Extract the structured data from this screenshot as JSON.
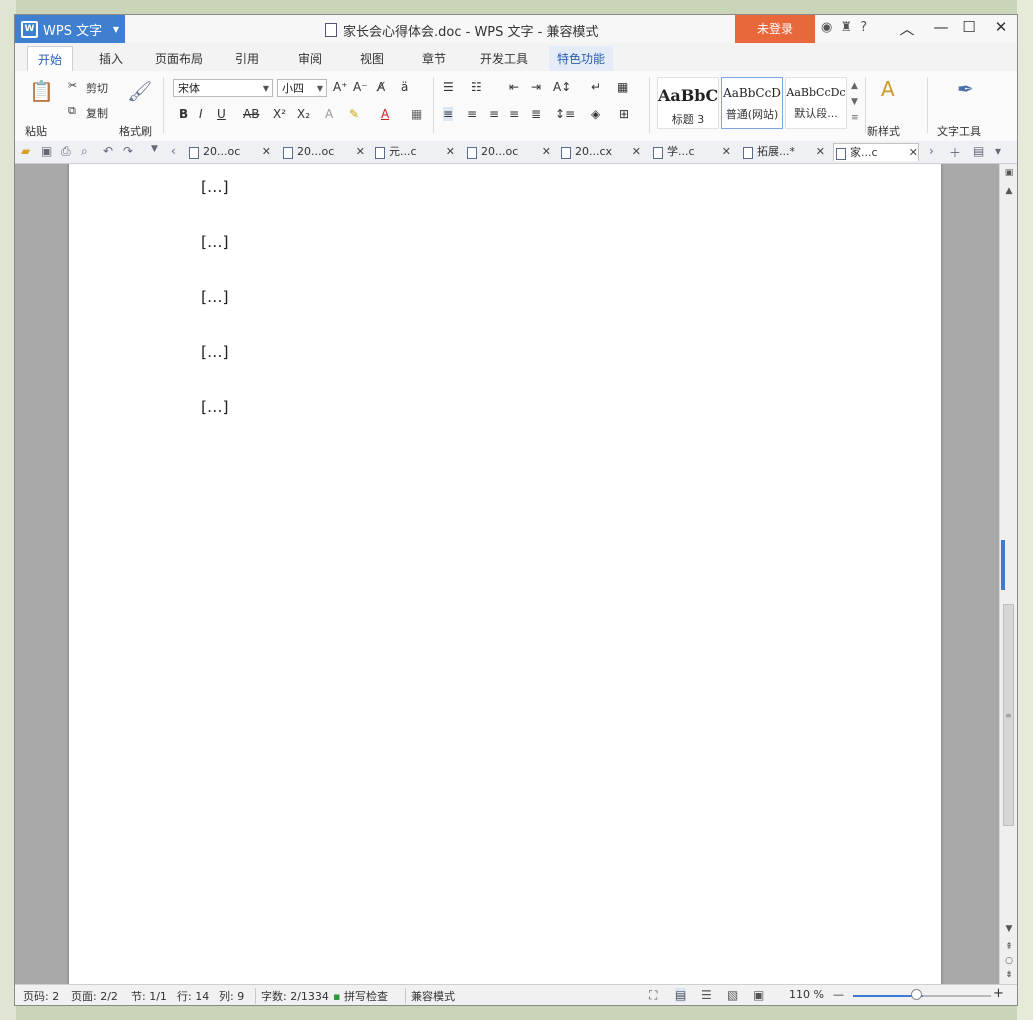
{
  "app": {
    "button_label": "WPS 文字",
    "logo_glyph": "W",
    "window_title": "家长会心得体会.doc - WPS 文字 - 兼容模式",
    "login_label": "未登录",
    "help_label": "?"
  },
  "menu_tabs": [
    {
      "label": "开始",
      "active": true
    },
    {
      "label": "插入"
    },
    {
      "label": "页面布局"
    },
    {
      "label": "引用"
    },
    {
      "label": "审阅"
    },
    {
      "label": "视图"
    },
    {
      "label": "章节"
    },
    {
      "label": "开发工具"
    },
    {
      "label": "特色功能",
      "highlight": true
    }
  ],
  "ribbon": {
    "paste_label": "粘贴",
    "cut_label": "剪切",
    "copy_label": "复制",
    "format_painter_label": "格式刷",
    "font_name": "宋体",
    "font_size": "小四",
    "styles": [
      {
        "sample": "AaBbC",
        "name": "标题 3"
      },
      {
        "sample": "AaBbCcD",
        "name": "普通(网站)",
        "selected": true
      },
      {
        "sample": "AaBbCcDc",
        "name": "默认段..."
      }
    ],
    "new_style_label": "新样式",
    "text_tools_label": "文字工具"
  },
  "doc_tabs": [
    {
      "label": "20...oc"
    },
    {
      "label": "20...oc"
    },
    {
      "label": "元...c"
    },
    {
      "label": "20...oc"
    },
    {
      "label": "20...cx"
    },
    {
      "label": "学...c"
    },
    {
      "label": "拓展...*"
    },
    {
      "label": "家...c",
      "active": true
    }
  ],
  "document": {
    "heading_3": "[…]",
    "para_1": "[…]",
    "heading_4": "[…]",
    "para_2": "[…]",
    "para_3": "[…]"
  },
  "status": {
    "page_no": "页码: 2",
    "pages": "页面: 2/2",
    "section": "节: 1/1",
    "row": "行: 14",
    "col": "列: 9",
    "word_count": "字数: 2/1334",
    "spell_check": "拼写检查",
    "compat_mode": "兼容模式",
    "zoom": "110 %"
  },
  "colors": {
    "accent": "#3e7fd0",
    "login": "#e8683b",
    "page_bg": "#a8a8a8"
  }
}
